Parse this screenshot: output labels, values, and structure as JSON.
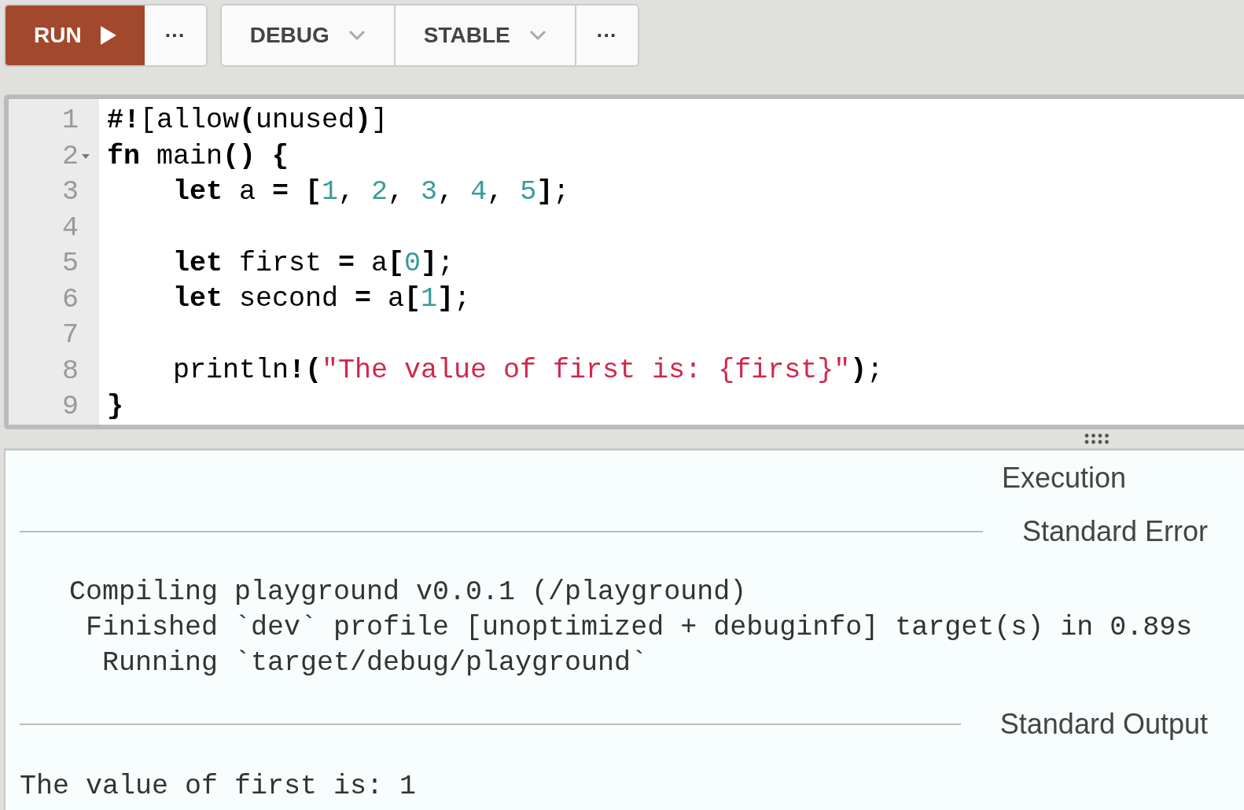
{
  "toolbar": {
    "run_button": "RUN",
    "run_more": "···",
    "mode_dropdown": "DEBUG",
    "channel_dropdown": "STABLE",
    "config_more": "···"
  },
  "editor": {
    "lines": [
      {
        "number": "1",
        "foldable": false,
        "indented": false,
        "tokens": [
          {
            "kind": "bold",
            "text": "#!"
          },
          {
            "kind": "plain",
            "text": "[allow"
          },
          {
            "kind": "bold",
            "text": "("
          },
          {
            "kind": "plain",
            "text": "unused"
          },
          {
            "kind": "bold",
            "text": ")"
          },
          {
            "kind": "plain",
            "text": "]"
          }
        ]
      },
      {
        "number": "2",
        "foldable": true,
        "indented": false,
        "tokens": [
          {
            "kind": "keyword",
            "text": "fn"
          },
          {
            "kind": "plain",
            "text": " main"
          },
          {
            "kind": "bold",
            "text": "() {"
          }
        ]
      },
      {
        "number": "3",
        "foldable": false,
        "indented": true,
        "tokens": [
          {
            "kind": "keyword",
            "text": "let"
          },
          {
            "kind": "plain",
            "text": " a "
          },
          {
            "kind": "bold",
            "text": "= ["
          },
          {
            "kind": "number",
            "text": "1"
          },
          {
            "kind": "plain",
            "text": ", "
          },
          {
            "kind": "number",
            "text": "2"
          },
          {
            "kind": "plain",
            "text": ", "
          },
          {
            "kind": "number",
            "text": "3"
          },
          {
            "kind": "plain",
            "text": ", "
          },
          {
            "kind": "number",
            "text": "4"
          },
          {
            "kind": "plain",
            "text": ", "
          },
          {
            "kind": "number",
            "text": "5"
          },
          {
            "kind": "bold",
            "text": "]"
          },
          {
            "kind": "plain",
            "text": ";"
          }
        ]
      },
      {
        "number": "4",
        "foldable": false
      },
      {
        "number": "5",
        "foldable": false,
        "indented": true,
        "tokens": [
          {
            "kind": "keyword",
            "text": "let"
          },
          {
            "kind": "plain",
            "text": " first "
          },
          {
            "kind": "bold",
            "text": "="
          },
          {
            "kind": "plain",
            "text": " a"
          },
          {
            "kind": "bold",
            "text": "["
          },
          {
            "kind": "number",
            "text": "0"
          },
          {
            "kind": "bold",
            "text": "]"
          },
          {
            "kind": "plain",
            "text": ";"
          }
        ]
      },
      {
        "number": "6",
        "foldable": false,
        "indented": true,
        "tokens": [
          {
            "kind": "keyword",
            "text": "let"
          },
          {
            "kind": "plain",
            "text": " second "
          },
          {
            "kind": "bold",
            "text": "="
          },
          {
            "kind": "plain",
            "text": " a"
          },
          {
            "kind": "bold",
            "text": "["
          },
          {
            "kind": "number",
            "text": "1"
          },
          {
            "kind": "bold",
            "text": "]"
          },
          {
            "kind": "plain",
            "text": ";"
          }
        ]
      },
      {
        "number": "7",
        "foldable": false
      },
      {
        "number": "8",
        "foldable": false,
        "indented": true,
        "tokens": [
          {
            "kind": "plain",
            "text": "println"
          },
          {
            "kind": "bold",
            "text": "!("
          },
          {
            "kind": "string",
            "text": "\"The value of first is: {first}\""
          },
          {
            "kind": "bold",
            "text": ")"
          },
          {
            "kind": "plain",
            "text": ";"
          }
        ]
      },
      {
        "number": "9",
        "foldable": false,
        "indented": false,
        "tokens": [
          {
            "kind": "bold",
            "text": "}"
          }
        ]
      }
    ]
  },
  "output": {
    "heading": "Execution",
    "sections": [
      {
        "title": "Standard Error",
        "lines": [
          "   Compiling playground v0.0.1 (/playground)",
          "    Finished `dev` profile [unoptimized + debuginfo] target(s) in 0.89s",
          "     Running `target/debug/playground`"
        ]
      },
      {
        "title": "Standard Output",
        "lines": [
          "The value of first is: 1"
        ]
      }
    ]
  }
}
